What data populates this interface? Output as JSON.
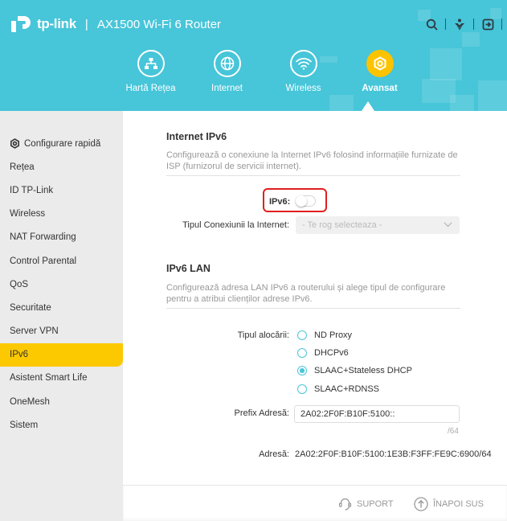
{
  "header": {
    "brand": "tp-link",
    "separator": "|",
    "model": "AX1500 Wi-Fi 6 Router",
    "icons": [
      "search-icon",
      "download-icon",
      "logout-icon"
    ]
  },
  "nav": {
    "items": [
      {
        "label": "Hartă Rețea",
        "icon": "network-map-icon",
        "active": false
      },
      {
        "label": "Internet",
        "icon": "globe-icon",
        "active": false
      },
      {
        "label": "Wireless",
        "icon": "wifi-icon",
        "active": false
      },
      {
        "label": "Avansat",
        "icon": "gear-icon",
        "active": true
      }
    ]
  },
  "sidebar": {
    "items": [
      {
        "label": "Configurare rapidă",
        "icon": "gear-icon"
      },
      {
        "label": "Rețea"
      },
      {
        "label": "ID TP-Link"
      },
      {
        "label": "Wireless"
      },
      {
        "label": "NAT Forwarding"
      },
      {
        "label": "Control Parental"
      },
      {
        "label": "QoS"
      },
      {
        "label": "Securitate"
      },
      {
        "label": "Server VPN"
      },
      {
        "label": "IPv6",
        "active": true
      },
      {
        "label": "Asistent Smart Life"
      },
      {
        "label": "OneMesh"
      },
      {
        "label": "Sistem"
      }
    ]
  },
  "internet_ipv6": {
    "title": "Internet IPv6",
    "description": "Configurează o conexiune la Internet IPv6 folosind informațiile furnizate de ISP (furnizorul de servicii internet).",
    "toggle_label": "IPv6:",
    "toggle_on": false,
    "connection_type_label": "Tipul Conexiunii la Internet:",
    "connection_type_placeholder": "- Te rog selecteaza -"
  },
  "ipv6_lan": {
    "title": "IPv6 LAN",
    "description": "Configurează adresa LAN IPv6 a routerului și alege tipul de configurare pentru a atribui clienților adrese IPv6.",
    "allocation_label": "Tipul alocării:",
    "allocation_options": [
      {
        "label": "ND Proxy",
        "checked": false
      },
      {
        "label": "DHCPv6",
        "checked": false
      },
      {
        "label": "SLAAC+Stateless DHCP",
        "checked": true
      },
      {
        "label": "SLAAC+RDNSS",
        "checked": false
      }
    ],
    "prefix_label": "Prefix Adresă:",
    "prefix_value": "2A02:2F0F:B10F:5100::",
    "prefix_suffix": "/64",
    "address_label": "Adresă:",
    "address_value": "2A02:2F0F:B10F:5100:1E3B:F3FF:FE9C:6900/64"
  },
  "footer": {
    "support": "SUPORT",
    "back_to_top": "ÎNAPOI SUS"
  },
  "colors": {
    "header_bg": "#47c5d9",
    "accent_yellow": "#fcc800",
    "radio_accent": "#4ac6d9",
    "highlight_red": "#e02020"
  }
}
